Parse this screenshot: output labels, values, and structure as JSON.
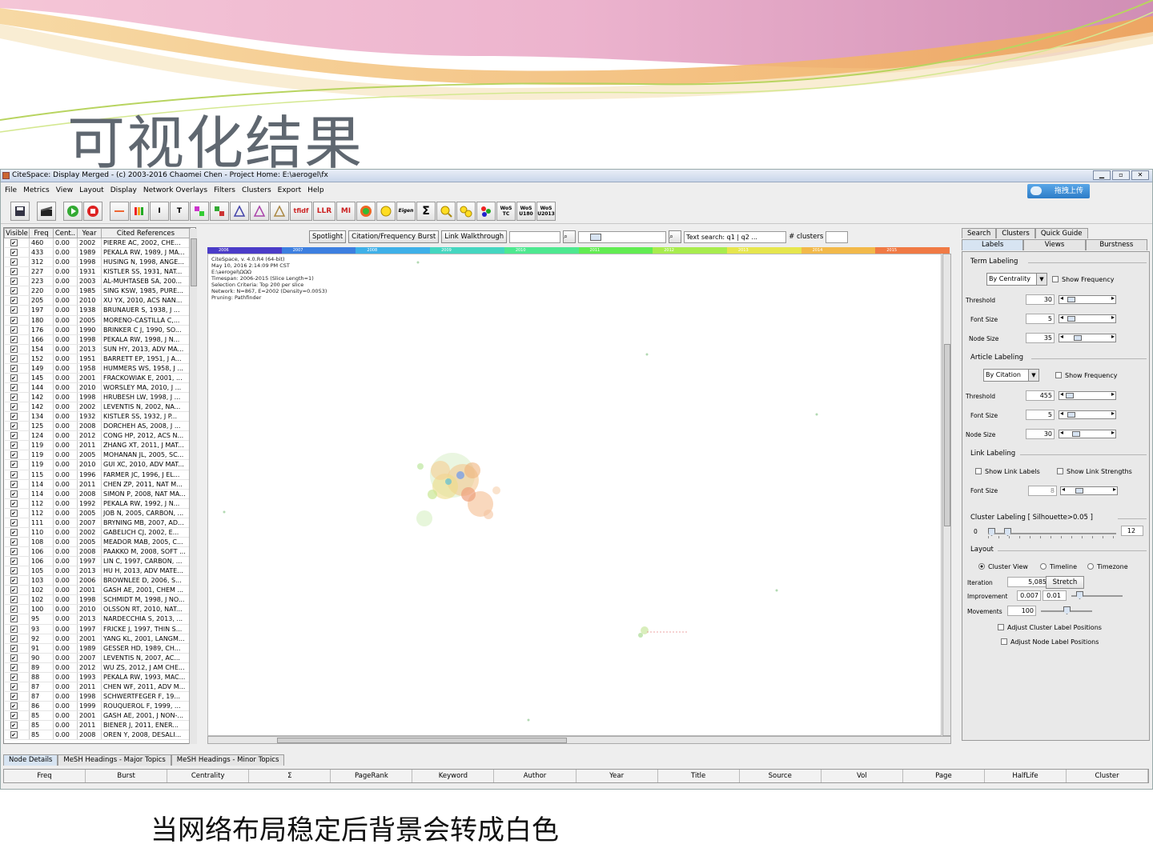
{
  "slide": {
    "title": "可视化结果",
    "caption": "当网络布局稳定后背景会转成白色"
  },
  "window": {
    "title": "CiteSpace: Display Merged - (c) 2003-2016 Chaomei Chen - Project Home: E:\\aerogel\\fx",
    "menu": [
      "File",
      "Metrics",
      "View",
      "Layout",
      "Display",
      "Network Overlays",
      "Filters",
      "Clusters",
      "Export",
      "Help"
    ],
    "upload_label": "拖拽上传",
    "toolbar_labels": [
      "tfidf",
      "LLR",
      "MI",
      "Eigen",
      "Σ",
      "WoS TC",
      "WoS U180",
      "WoS U2013"
    ]
  },
  "table": {
    "headers": [
      "Visible",
      "Freq",
      "Cent..",
      "Year",
      "Cited References"
    ],
    "rows": [
      [
        "460",
        "0.00",
        "2002",
        "PIERRE AC, 2002, CHE..."
      ],
      [
        "433",
        "0.00",
        "1989",
        "PEKALA RW, 1989, J MA..."
      ],
      [
        "312",
        "0.00",
        "1998",
        "HUSING N, 1998, ANGE..."
      ],
      [
        "227",
        "0.00",
        "1931",
        "KISTLER SS, 1931, NAT..."
      ],
      [
        "223",
        "0.00",
        "2003",
        "AL-MUHTASEB SA, 200..."
      ],
      [
        "220",
        "0.00",
        "1985",
        "SING KSW, 1985, PURE..."
      ],
      [
        "205",
        "0.00",
        "2010",
        "XU YX, 2010, ACS NAN..."
      ],
      [
        "197",
        "0.00",
        "1938",
        "BRUNAUER S, 1938, J ..."
      ],
      [
        "180",
        "0.00",
        "2005",
        "MORENO-CASTILLA C,..."
      ],
      [
        "176",
        "0.00",
        "1990",
        "BRINKER C J, 1990, SO..."
      ],
      [
        "166",
        "0.00",
        "1998",
        "PEKALA RW, 1998, J N..."
      ],
      [
        "154",
        "0.00",
        "2013",
        "SUN HY, 2013, ADV MA..."
      ],
      [
        "152",
        "0.00",
        "1951",
        "BARRETT EP, 1951, J A..."
      ],
      [
        "149",
        "0.00",
        "1958",
        "HUMMERS WS, 1958, J ..."
      ],
      [
        "145",
        "0.00",
        "2001",
        "FRACKOWIAK E, 2001, ..."
      ],
      [
        "144",
        "0.00",
        "2010",
        "WORSLEY MA, 2010, J ..."
      ],
      [
        "142",
        "0.00",
        "1998",
        "HRUBESH LW, 1998, J ..."
      ],
      [
        "142",
        "0.00",
        "2002",
        "LEVENTIS N, 2002, NA..."
      ],
      [
        "134",
        "0.00",
        "1932",
        "KISTLER SS, 1932, J P..."
      ],
      [
        "125",
        "0.00",
        "2008",
        "DORCHEH AS, 2008, J ..."
      ],
      [
        "124",
        "0.00",
        "2012",
        "CONG HP, 2012, ACS N..."
      ],
      [
        "119",
        "0.00",
        "2011",
        "ZHANG XT, 2011, J MAT..."
      ],
      [
        "119",
        "0.00",
        "2005",
        "MOHANAN JL, 2005, SC..."
      ],
      [
        "119",
        "0.00",
        "2010",
        "GUI XC, 2010, ADV MAT..."
      ],
      [
        "115",
        "0.00",
        "1996",
        "FARMER JC, 1996, J EL..."
      ],
      [
        "114",
        "0.00",
        "2011",
        "CHEN ZP, 2011, NAT M..."
      ],
      [
        "114",
        "0.00",
        "2008",
        "SIMON P, 2008, NAT MA..."
      ],
      [
        "112",
        "0.00",
        "1992",
        "PEKALA RW, 1992, J N..."
      ],
      [
        "112",
        "0.00",
        "2005",
        "JOB N, 2005, CARBON, ..."
      ],
      [
        "111",
        "0.00",
        "2007",
        "BRYNING MB, 2007, AD..."
      ],
      [
        "110",
        "0.00",
        "2002",
        "GABELICH CJ, 2002, E..."
      ],
      [
        "108",
        "0.00",
        "2005",
        "MEADOR MAB, 2005, C..."
      ],
      [
        "106",
        "0.00",
        "2008",
        "PAAKKO M, 2008, SOFT ..."
      ],
      [
        "106",
        "0.00",
        "1997",
        "LIN C, 1997, CARBON, ..."
      ],
      [
        "105",
        "0.00",
        "2013",
        "HU H, 2013, ADV MATE..."
      ],
      [
        "103",
        "0.00",
        "2006",
        "BROWNLEE D, 2006, S..."
      ],
      [
        "102",
        "0.00",
        "2001",
        "GASH AE, 2001, CHEM ..."
      ],
      [
        "102",
        "0.00",
        "1998",
        "SCHMIDT M, 1998, J NO..."
      ],
      [
        "100",
        "0.00",
        "2010",
        "OLSSON RT, 2010, NAT..."
      ],
      [
        "95",
        "0.00",
        "2013",
        "NARDECCHIA S, 2013, ..."
      ],
      [
        "93",
        "0.00",
        "1997",
        "FRICKE J, 1997, THIN S..."
      ],
      [
        "92",
        "0.00",
        "2001",
        "YANG KL, 2001, LANGM..."
      ],
      [
        "91",
        "0.00",
        "1989",
        "GESSER HD, 1989, CH..."
      ],
      [
        "90",
        "0.00",
        "2007",
        "LEVENTIS N, 2007, AC..."
      ],
      [
        "89",
        "0.00",
        "2012",
        "WU ZS, 2012, J AM CHE..."
      ],
      [
        "88",
        "0.00",
        "1993",
        "PEKALA RW, 1993, MAC..."
      ],
      [
        "87",
        "0.00",
        "2011",
        "CHEN WF, 2011, ADV M..."
      ],
      [
        "87",
        "0.00",
        "1998",
        "SCHWERTFEGER F, 19..."
      ],
      [
        "86",
        "0.00",
        "1999",
        "ROUQUEROL F, 1999, ..."
      ],
      [
        "85",
        "0.00",
        "2001",
        "GASH AE, 2001, J NON-..."
      ],
      [
        "85",
        "0.00",
        "2011",
        "BIENER J, 2011, ENER..."
      ],
      [
        "85",
        "0.00",
        "2008",
        "OREN Y, 2008, DESALI..."
      ]
    ]
  },
  "center": {
    "spotlight": "Spotlight",
    "burst": "Citation/Frequency Burst",
    "walkthrough": "Link Walkthrough",
    "search_placeholder": "Text search: q1 | q2 ...",
    "clusters_label": "# clusters",
    "years": [
      "2006",
      "2007",
      "2008",
      "2009",
      "2010",
      "2011",
      "2012",
      "2013",
      "2014",
      "2015"
    ],
    "year_colors": [
      "#4b3cc8",
      "#3d7fe0",
      "#3fb0e8",
      "#45d6c0",
      "#4ee890",
      "#62ec52",
      "#a8ec4e",
      "#e6e64e",
      "#f2b94a",
      "#f07a45"
    ],
    "info": "CiteSpace, v. 4.0.R4 (64-bit)\nMay 10, 2016 2:14:09 PM CST\nE:\\aerogel\\ΩΩΩ\nTimespan: 2006-2015 (Slice Length=1)\nSelection Criteria: Top 200 per slice\nNetwork: N=867, E=2002 (Density=0.0053)\nPruning: Pathfinder"
  },
  "right": {
    "tabs_top": [
      "Search",
      "Clusters",
      "Quick Guide"
    ],
    "tabs_sub": [
      "Labels",
      "Views",
      "Burstness"
    ],
    "term_labeling": {
      "title": "Term Labeling",
      "combo": "By Centrality",
      "show_frequency": "Show Frequency",
      "threshold_label": "Threshold",
      "threshold": "30",
      "font_label": "Font Size",
      "font": "5",
      "node_label": "Node Size",
      "node": "35"
    },
    "article_labeling": {
      "title": "Article Labeling",
      "combo": "By Citation",
      "show_frequency": "Show Frequency",
      "threshold_label": "Threshold",
      "threshold": "455",
      "font_label": "Font Size",
      "font": "5",
      "node_label": "Node Size",
      "node": "30"
    },
    "link_labeling": {
      "title": "Link Labeling",
      "show_labels": "Show Link Labels",
      "show_strengths": "Show Link Strengths",
      "font_label": "Font Size",
      "font": "8"
    },
    "cluster_labeling": {
      "title": "Cluster Labeling [ Silhouette>0.05 ]",
      "min": "0",
      "max": "12"
    },
    "layout": {
      "title": "Layout",
      "radios": [
        "Cluster View",
        "Timeline",
        "Timezone"
      ],
      "iteration_label": "Iteration",
      "iteration": "5,085",
      "stretch": "Stretch",
      "improvement_label": "Improvement",
      "improvement": "0.007",
      "improvement2": "0.01",
      "movements_label": "Movements",
      "movements": "100",
      "adjust_cluster": "Adjust Cluster Label Positions",
      "adjust_node": "Adjust Node Label Positions"
    }
  },
  "bottom": {
    "tabs": [
      "Node Details",
      "MeSH Headings - Major Topics",
      "MeSH Headings - Minor Topics"
    ],
    "columns": [
      "Freq",
      "Burst",
      "Centrality",
      "Σ",
      "PageRank",
      "Keyword",
      "Author",
      "Year",
      "Title",
      "Source",
      "Vol",
      "Page",
      "HalfLife",
      "Cluster"
    ]
  }
}
